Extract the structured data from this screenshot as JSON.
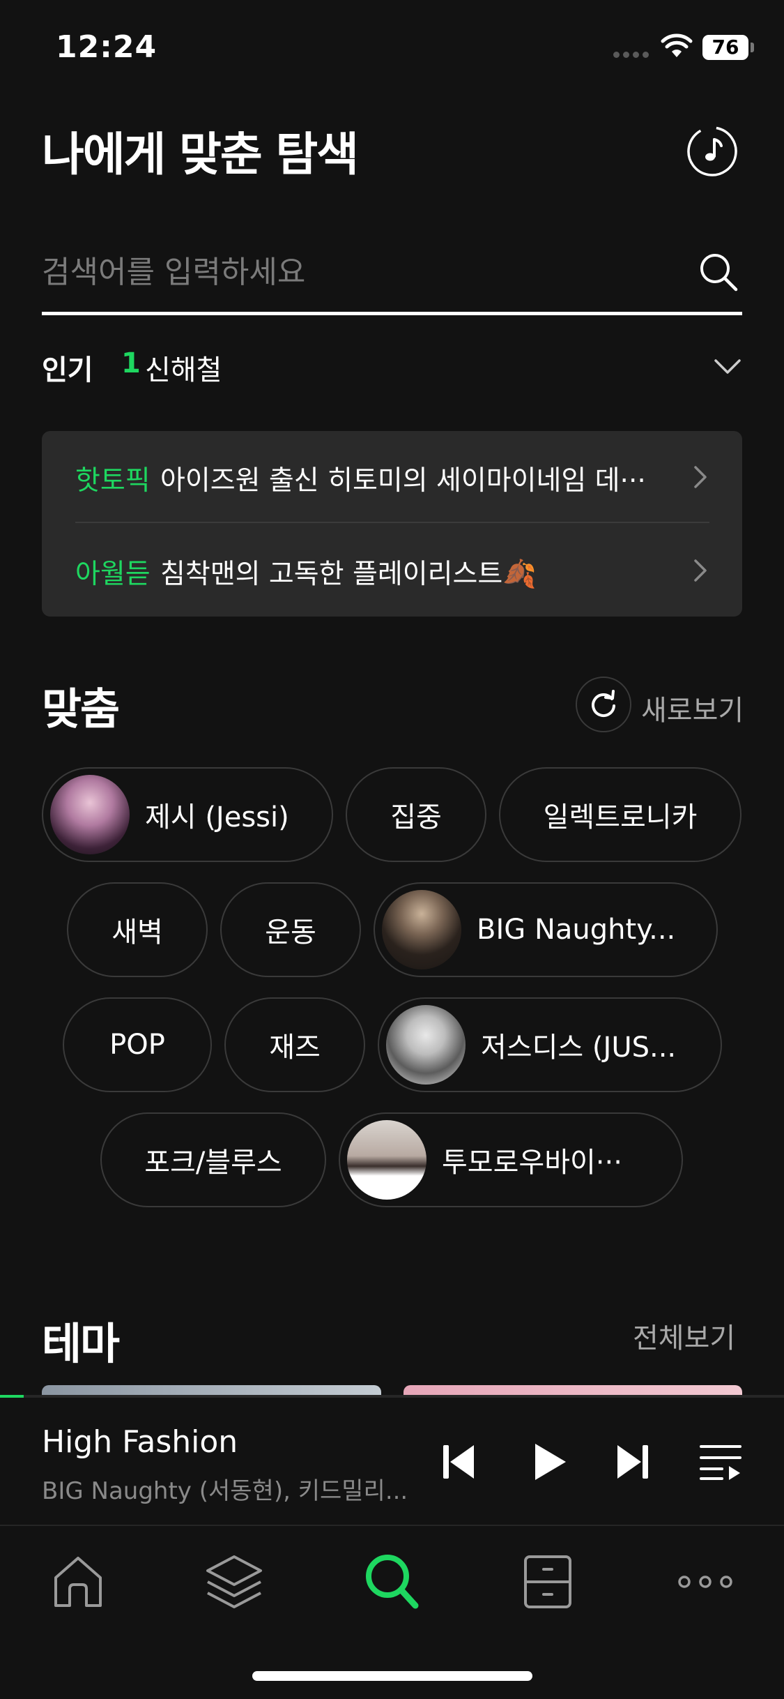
{
  "status_bar": {
    "time": "12:24",
    "battery": "76"
  },
  "header": {
    "title": "나에게 맞춘 탐색",
    "music_icon": "music-note-icon"
  },
  "search": {
    "placeholder": "검색어를 입력하세요",
    "value": ""
  },
  "popular": {
    "label": "인기",
    "rank": "1",
    "term": "신해철"
  },
  "topics": [
    {
      "tag": "핫토픽",
      "text": "아이즈원 출신 히토미의 세이마이네임 데···"
    },
    {
      "tag": "아월듣",
      "text": "침착맨의 고독한 플레이리스트🍂"
    }
  ],
  "custom": {
    "title": "맞춤",
    "refresh_label": "새로보기",
    "chips": [
      {
        "label": "제시 (Jessi)",
        "has_image": true
      },
      {
        "label": "집중",
        "has_image": false
      },
      {
        "label": "일렉트로니카",
        "has_image": false
      },
      {
        "label": "새벽",
        "has_image": false
      },
      {
        "label": "운동",
        "has_image": false
      },
      {
        "label": "BIG Naughty...",
        "has_image": true
      },
      {
        "label": "POP",
        "has_image": false
      },
      {
        "label": "재즈",
        "has_image": false
      },
      {
        "label": "저스디스 (JUS...",
        "has_image": true
      },
      {
        "label": "포크/블루스",
        "has_image": false
      },
      {
        "label": "투모로우바이···",
        "has_image": true
      }
    ]
  },
  "theme": {
    "title": "테마",
    "view_all": "전체보기"
  },
  "player": {
    "title": "High Fashion",
    "artist": "BIG Naughty (서동현), 키드밀리...",
    "progress": 0.03
  },
  "tabs": [
    "home-icon",
    "layers-icon",
    "search-icon",
    "locker-icon",
    "more-icon"
  ],
  "colors": {
    "accent": "#1ed760",
    "background": "#121212",
    "card": "#2a2a2a"
  }
}
